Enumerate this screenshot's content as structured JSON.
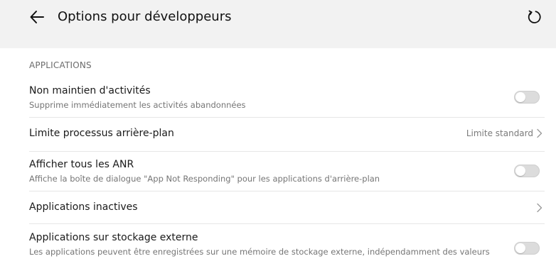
{
  "appbar": {
    "title": "Options pour développeurs",
    "back_icon": "arrow-back-icon",
    "reset_icon": "refresh-icon"
  },
  "section": {
    "header": "APPLICATIONS"
  },
  "rows": [
    {
      "title": "Non maintien d'activités",
      "subtitle": "Supprime immédiatement les activités abandonnées",
      "control": "toggle",
      "checked": false
    },
    {
      "title": "Limite processus arrière-plan",
      "value": "Limite standard",
      "control": "chevron"
    },
    {
      "title": "Afficher tous les ANR",
      "subtitle": "Affiche la boîte de dialogue \"App Not Responding\" pour les applications d'arrière-plan",
      "control": "toggle",
      "checked": false
    },
    {
      "title": "Applications inactives",
      "control": "chevron"
    },
    {
      "title": "Applications sur stockage externe",
      "subtitle": "Les applications peuvent être enregistrées sur une mémoire de stockage externe, indépendamment des valeurs",
      "control": "toggle",
      "checked": false
    }
  ],
  "colors": {
    "background": "#f2f2f2",
    "card": "#ffffff",
    "toggle_off": "#dcdcdc"
  }
}
